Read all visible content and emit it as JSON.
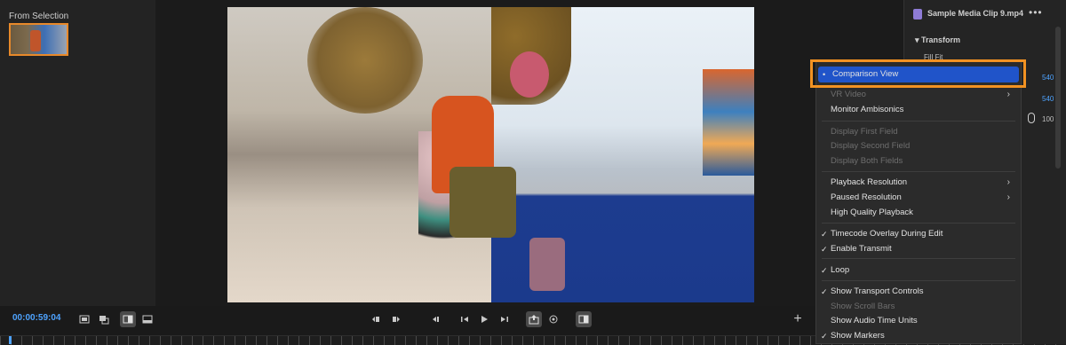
{
  "source_panel": {
    "label": "From Selection"
  },
  "monitor": {
    "timecode": "00:00:59:04",
    "add_button": "+"
  },
  "effect_controls": {
    "clip_title": "Sample Media Clip 9.mp4",
    "more": "•••",
    "transform": "Transform",
    "fill_fit": "Fill  Fit",
    "values": [
      "540",
      "540",
      "100"
    ]
  },
  "context_menu": {
    "items": [
      {
        "label": "Comparison View",
        "check": "•",
        "selected": true
      },
      {
        "label": "VR Video",
        "disabled": true,
        "submenu": true
      },
      {
        "label": "Monitor Ambisonics"
      },
      {
        "label": "Display First Field",
        "disabled": true
      },
      {
        "label": "Display Second Field",
        "disabled": true
      },
      {
        "label": "Display Both Fields",
        "disabled": true
      },
      {
        "label": "Playback Resolution",
        "submenu": true
      },
      {
        "label": "Paused Resolution",
        "submenu": true
      },
      {
        "label": "High Quality Playback"
      },
      {
        "label": "Timecode Overlay During Edit",
        "check": "✓"
      },
      {
        "label": "Enable Transmit",
        "check": "✓"
      },
      {
        "label": "Loop",
        "check": "✓"
      },
      {
        "label": "Show Transport Controls",
        "check": "✓"
      },
      {
        "label": "Show Scroll Bars",
        "disabled": true
      },
      {
        "label": "Show Audio Time Units"
      },
      {
        "label": "Show Markers",
        "check": "✓"
      }
    ]
  },
  "colors": {
    "accent": "#4ea3ff",
    "menu_selection": "#2054c9",
    "callout": "#f29222"
  }
}
